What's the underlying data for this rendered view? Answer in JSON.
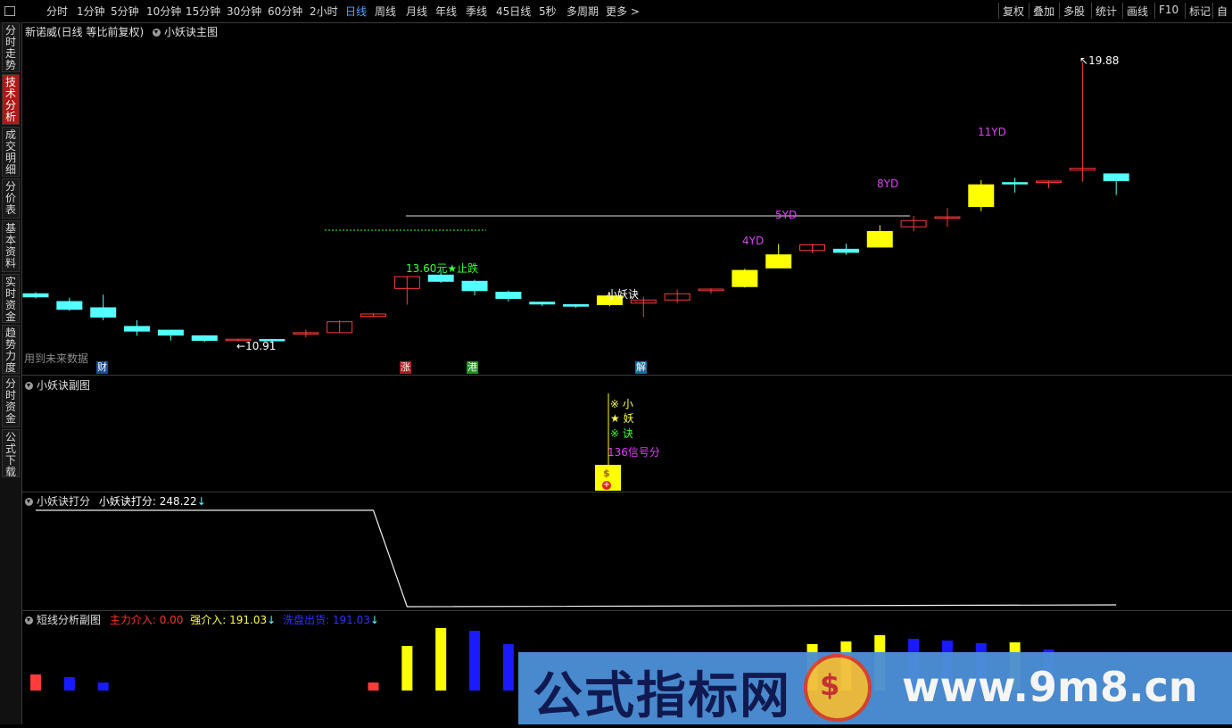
{
  "toolbar": {
    "periods": [
      "分时",
      "1分钟",
      "5分钟",
      "10分钟",
      "15分钟",
      "30分钟",
      "60分钟",
      "2小时",
      "日线",
      "周线",
      "月线",
      "年线",
      "季线",
      "45日线",
      "5秒",
      "多周期",
      "更多 >"
    ],
    "active_period": "日线",
    "right_tools": [
      "复权",
      "叠加",
      "多股",
      "统计",
      "画线",
      "F10",
      "标记",
      "自"
    ]
  },
  "sidebar": {
    "tabs": [
      "分时走势",
      "技术分析",
      "成交明细",
      "分价表",
      "基本资料",
      "实时资金",
      "趋势力度",
      "分时资金",
      "公式下载"
    ],
    "active": "技术分析"
  },
  "main_panel": {
    "title": "新诺威(日线 等比前复权)",
    "indicator": "小妖诀主图",
    "future_data_note": "用到未来数据",
    "high_label": "19.88",
    "low_label": "10.91",
    "stop_label": "13.60元★止跌",
    "signal_label": "小妖诀",
    "yd_labels": [
      "4YD",
      "5YD",
      "8YD",
      "11YD"
    ],
    "event_tags": [
      "财",
      "涨",
      "港",
      "解"
    ]
  },
  "sub_panel1": {
    "title": "小妖诀副图",
    "lines": [
      "※ 小",
      "★ 妖",
      "※ 诀"
    ],
    "score_label": "136信号分"
  },
  "sub_panel2": {
    "title": "小妖诀打分",
    "value_label": "小妖诀打分: 248.22",
    "arrow": "↓"
  },
  "sub_panel3": {
    "title": "短线分析副图",
    "item1": "主力介入: 0.00",
    "item2": "强介入: 191.03",
    "item3": "洗盘出货: 191.03",
    "arrow": "↓"
  },
  "watermark": {
    "left_text": "公式指标网",
    "right_text": "www.9m8.cn",
    "logo_glyph": "$"
  },
  "colors": {
    "up": "#ff3b3b",
    "down": "#54ffff",
    "signal": "#ffff00",
    "purple": "#e040fb",
    "green": "#39ff39",
    "blue": "#1a1aff"
  },
  "chart_data": {
    "type": "candlestick",
    "candles": [
      {
        "o": 12.45,
        "h": 12.5,
        "l": 12.3,
        "c": 12.35,
        "color": "cyan"
      },
      {
        "o": 12.2,
        "h": 12.32,
        "l": 11.9,
        "c": 11.95,
        "color": "cyan"
      },
      {
        "o": 12.0,
        "h": 12.42,
        "l": 11.6,
        "c": 11.7,
        "color": "cyan"
      },
      {
        "o": 11.4,
        "h": 11.6,
        "l": 11.1,
        "c": 11.25,
        "color": "cyan"
      },
      {
        "o": 11.28,
        "h": 11.28,
        "l": 10.95,
        "c": 11.12,
        "color": "cyan"
      },
      {
        "o": 11.1,
        "h": 11.12,
        "l": 10.9,
        "c": 10.95,
        "color": "cyan"
      },
      {
        "o": 10.98,
        "h": 11.0,
        "l": 10.91,
        "c": 10.99,
        "color": "red"
      },
      {
        "o": 10.98,
        "h": 11.0,
        "l": 10.9,
        "c": 10.95,
        "color": "cyan"
      },
      {
        "o": 11.18,
        "h": 11.3,
        "l": 11.05,
        "c": 11.2,
        "color": "red"
      },
      {
        "o": 11.2,
        "h": 11.6,
        "l": 11.2,
        "c": 11.55,
        "color": "red"
      },
      {
        "o": 11.72,
        "h": 11.8,
        "l": 11.7,
        "c": 11.8,
        "color": "red"
      },
      {
        "o": 12.62,
        "h": 13.0,
        "l": 12.1,
        "c": 13.0,
        "color": "red"
      },
      {
        "o": 13.05,
        "h": 13.2,
        "l": 12.8,
        "c": 12.85,
        "color": "cyan"
      },
      {
        "o": 12.85,
        "h": 12.9,
        "l": 12.4,
        "c": 12.55,
        "color": "cyan"
      },
      {
        "o": 12.5,
        "h": 12.55,
        "l": 12.2,
        "c": 12.3,
        "color": "cyan"
      },
      {
        "o": 12.18,
        "h": 12.2,
        "l": 12.05,
        "c": 12.12,
        "color": "cyan"
      },
      {
        "o": 12.1,
        "h": 12.12,
        "l": 12.0,
        "c": 12.05,
        "color": "cyan"
      },
      {
        "o": 12.1,
        "h": 12.48,
        "l": 12.05,
        "c": 12.38,
        "color": "yellow"
      },
      {
        "o": 12.15,
        "h": 12.35,
        "l": 11.7,
        "c": 12.25,
        "color": "red"
      },
      {
        "o": 12.25,
        "h": 12.58,
        "l": 12.15,
        "c": 12.45,
        "color": "red"
      },
      {
        "o": 12.55,
        "h": 12.62,
        "l": 12.45,
        "c": 12.6,
        "color": "red"
      },
      {
        "o": 12.68,
        "h": 13.25,
        "l": 12.65,
        "c": 13.2,
        "color": "yellow"
      },
      {
        "o": 13.28,
        "h": 14.05,
        "l": 13.28,
        "c": 13.7,
        "color": "yellow"
      },
      {
        "o": 13.84,
        "h": 14.05,
        "l": 13.75,
        "c": 14.02,
        "color": "red"
      },
      {
        "o": 13.88,
        "h": 14.06,
        "l": 13.7,
        "c": 13.78,
        "color": "cyan"
      },
      {
        "o": 13.95,
        "h": 14.65,
        "l": 13.95,
        "c": 14.45,
        "color": "yellow"
      },
      {
        "o": 14.6,
        "h": 14.95,
        "l": 14.45,
        "c": 14.8,
        "color": "red"
      },
      {
        "o": 14.9,
        "h": 15.2,
        "l": 14.6,
        "c": 14.92,
        "color": "red"
      },
      {
        "o": 15.25,
        "h": 16.1,
        "l": 15.1,
        "c": 15.95,
        "color": "yellow"
      },
      {
        "o": 16.0,
        "h": 16.18,
        "l": 15.7,
        "c": 16.02,
        "color": "cyan"
      },
      {
        "o": 16.05,
        "h": 16.08,
        "l": 15.85,
        "c": 16.07,
        "color": "red"
      },
      {
        "o": 16.42,
        "h": 19.88,
        "l": 16.05,
        "c": 16.48,
        "color": "red"
      },
      {
        "o": 16.3,
        "h": 16.3,
        "l": 15.62,
        "c": 16.08,
        "color": "cyan"
      }
    ],
    "score_line": [
      {
        "i": 0,
        "v": 248.22
      },
      {
        "i": 10,
        "v": 248.22
      },
      {
        "i": 11,
        "v": 30
      },
      {
        "i": 32,
        "v": 34
      }
    ],
    "short_bars": [
      {
        "i": 0,
        "v": 18,
        "c": "red"
      },
      {
        "i": 1,
        "v": 15,
        "c": "blue"
      },
      {
        "i": 2,
        "v": 9,
        "c": "blue"
      },
      {
        "i": 10,
        "v": 9,
        "c": "red"
      },
      {
        "i": 11,
        "v": 50,
        "c": "yellow"
      },
      {
        "i": 12,
        "v": 70,
        "c": "yellow"
      },
      {
        "i": 13,
        "v": 67,
        "c": "blue"
      },
      {
        "i": 14,
        "v": 52,
        "c": "blue"
      },
      {
        "i": 23,
        "v": 52,
        "c": "yellow"
      },
      {
        "i": 24,
        "v": 55,
        "c": "yellow"
      },
      {
        "i": 25,
        "v": 62,
        "c": "yellow"
      },
      {
        "i": 26,
        "v": 58,
        "c": "blue"
      },
      {
        "i": 27,
        "v": 56,
        "c": "blue"
      },
      {
        "i": 28,
        "v": 53,
        "c": "blue"
      },
      {
        "i": 29,
        "v": 54,
        "c": "yellow"
      },
      {
        "i": 30,
        "v": 46,
        "c": "blue"
      }
    ]
  }
}
